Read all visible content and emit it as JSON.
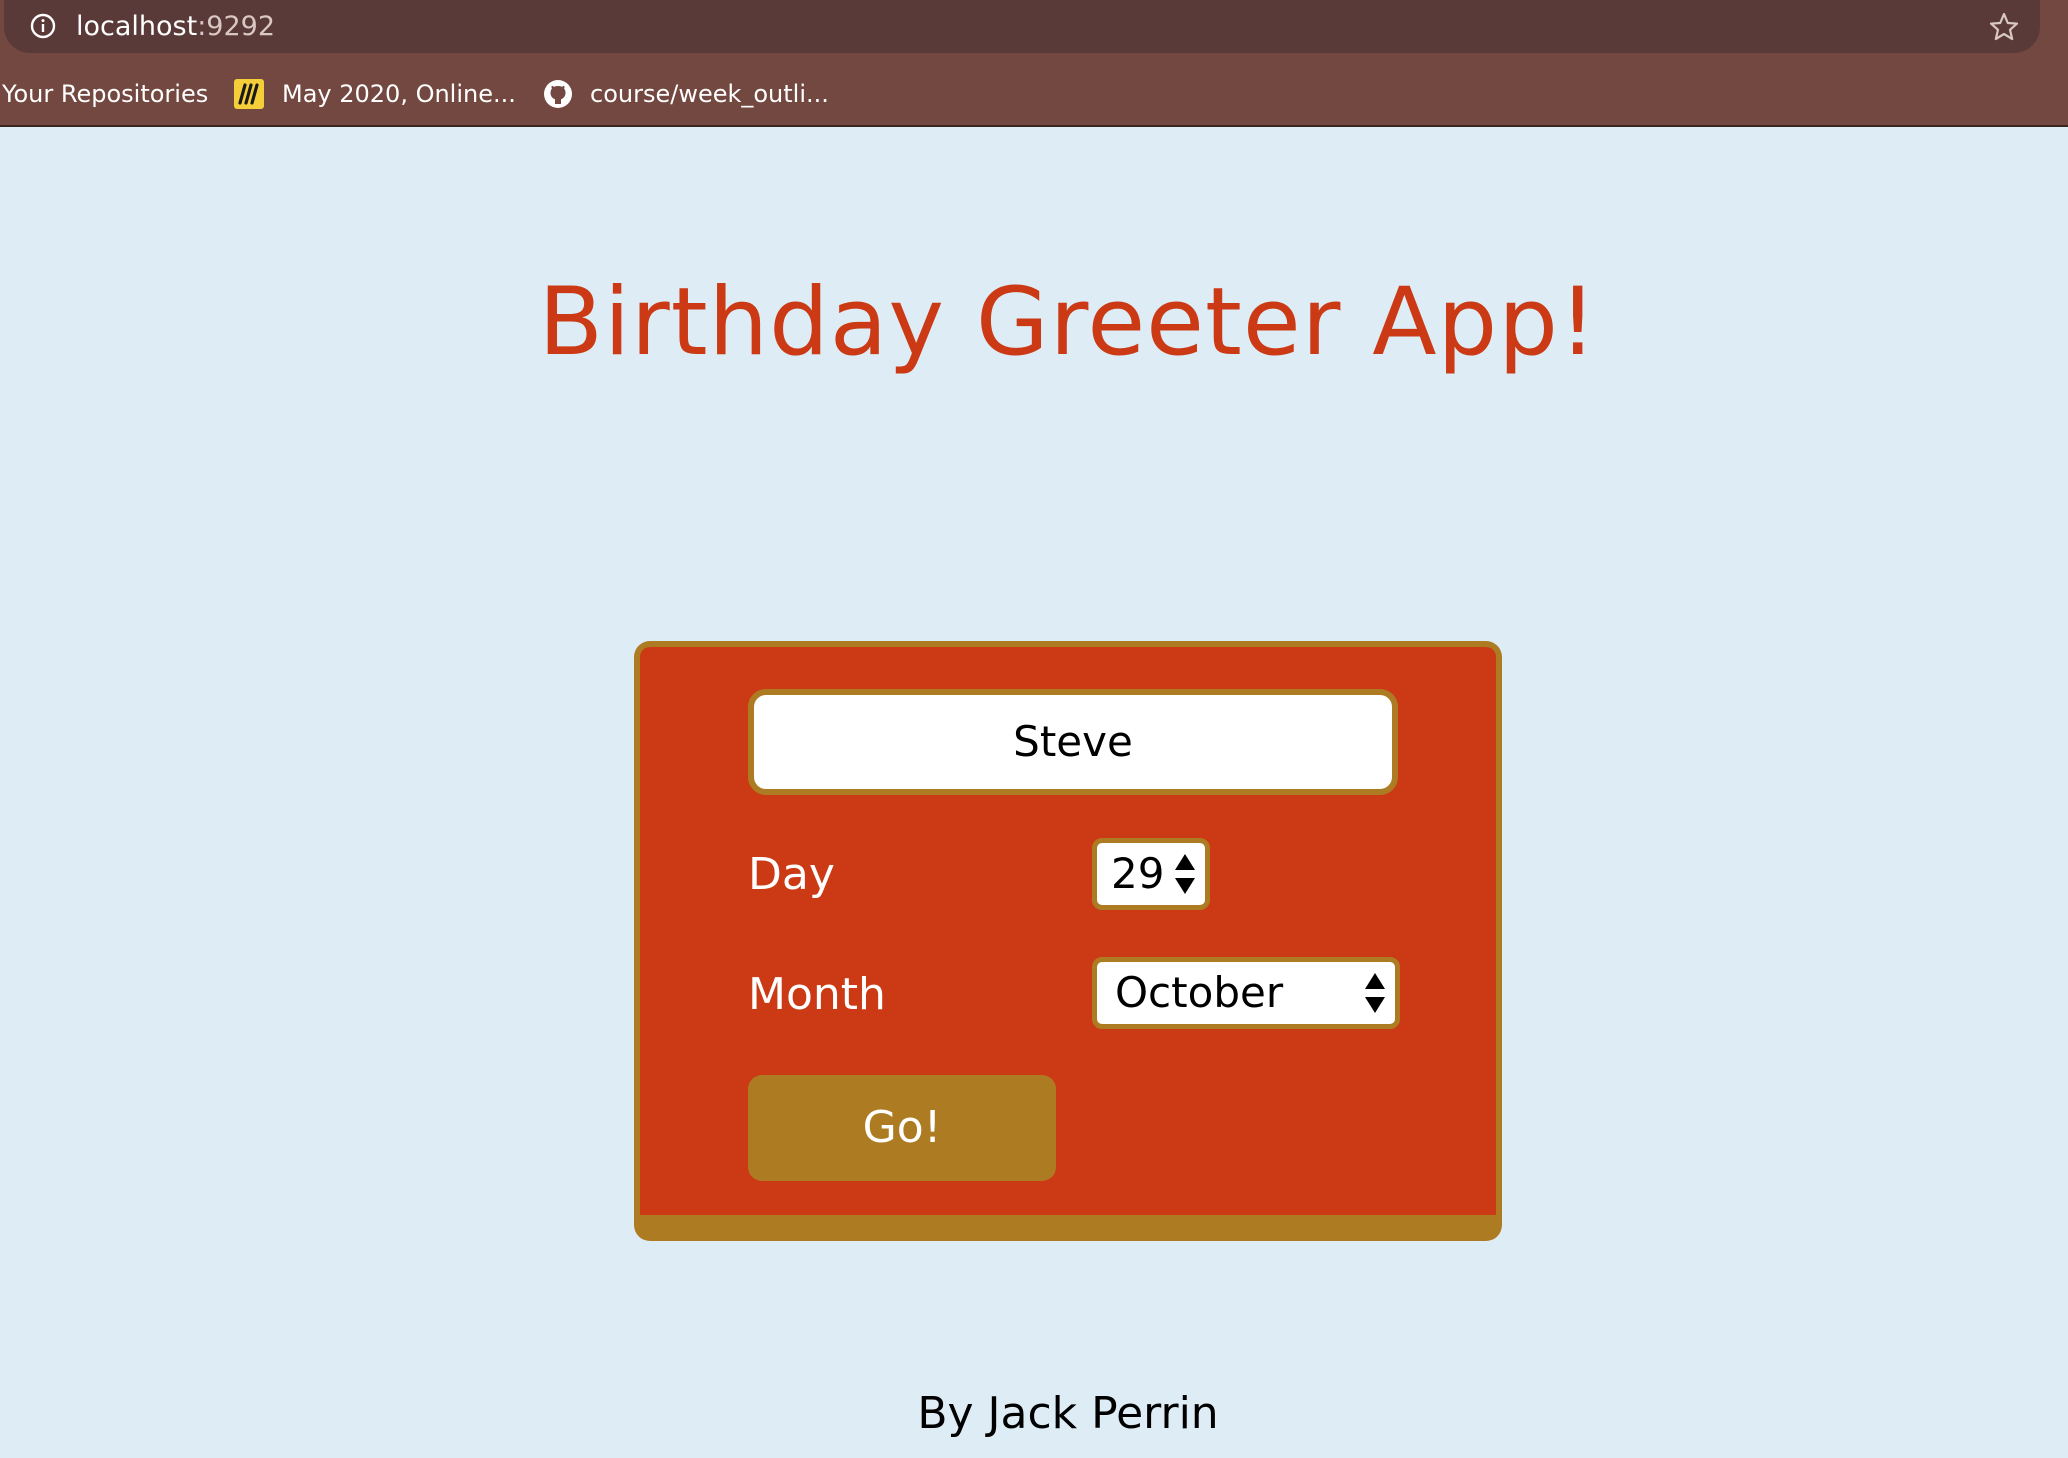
{
  "browser": {
    "url_host": "localhost",
    "url_port": ":9292",
    "bookmarks": [
      {
        "label": "Your Repositories"
      },
      {
        "label": "May 2020, Online..."
      },
      {
        "label": "course/week_outli..."
      }
    ]
  },
  "page": {
    "title": "Birthday Greeter App!",
    "form": {
      "name_value": "Steve",
      "day_label": "Day",
      "day_value": "29",
      "month_label": "Month",
      "month_value": "October",
      "submit_label": "Go!"
    },
    "author": "By Jack Perrin"
  },
  "colors": {
    "background": "#ddecf5",
    "accent_red": "#cb3a14",
    "accent_gold": "#ad7c22",
    "chrome": "#734840"
  },
  "icons": {
    "omnibox": "info-icon",
    "bookmark_star": "star-icon",
    "bookmark_2": "miro-icon",
    "bookmark_3": "github-icon",
    "number_spinner": "spinner-arrows-icon",
    "select_arrows": "select-arrows-icon"
  }
}
